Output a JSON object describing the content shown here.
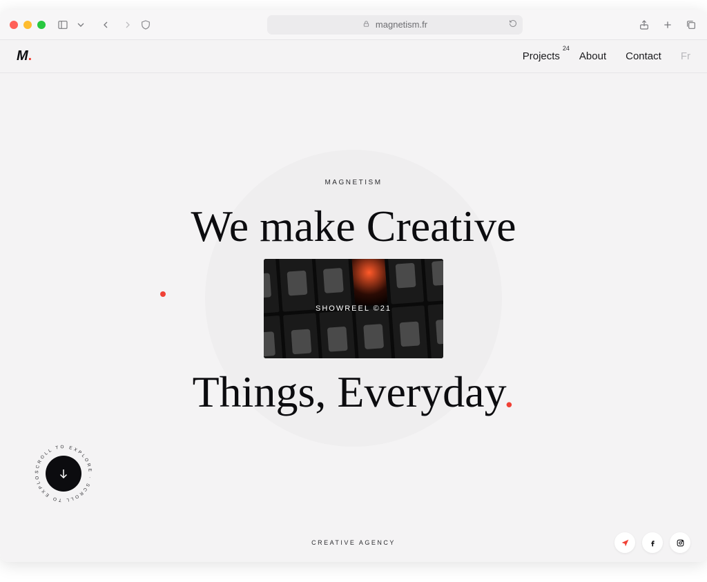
{
  "browser": {
    "url_display": "magnetism.fr"
  },
  "header": {
    "logo_text": "M",
    "logo_dot": ".",
    "nav": {
      "projects": "Projects",
      "projects_count": "24",
      "about": "About",
      "contact": "Contact",
      "lang": "Fr"
    }
  },
  "hero": {
    "eyebrow": "MAGNETISM",
    "line1": "We make Creative",
    "showreel_label": "SHOWREEL ©21",
    "line2_a": "Things, Everyday",
    "line2_dot": "."
  },
  "footer": {
    "tagline": "CREATIVE AGENCY",
    "scroll_text": "SCROLL TO EXPLORE · SCROLL TO EXPLORE ·"
  }
}
